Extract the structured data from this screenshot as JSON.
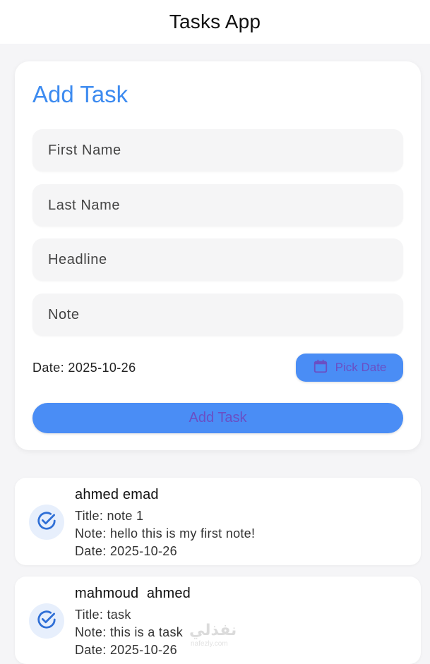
{
  "app": {
    "title": "Tasks App"
  },
  "form": {
    "title": "Add Task",
    "fields": {
      "first_name": {
        "placeholder": "First Name",
        "value": ""
      },
      "last_name": {
        "placeholder": "Last Name",
        "value": ""
      },
      "headline": {
        "placeholder": "Headline",
        "value": ""
      },
      "note": {
        "placeholder": "Note",
        "value": ""
      }
    },
    "date_text": "Date: 2025-10-26",
    "pick_date_label": "Pick Date",
    "pick_date_icon": "calendar-icon",
    "add_label": "Add Task"
  },
  "tasks": [
    {
      "name": "ahmed emad",
      "title": "Title: note 1",
      "note": "Note: hello this is my first note!",
      "date": "Date: 2025-10-26",
      "icon": "check-circle-icon"
    },
    {
      "name": "mahmoud  ahmed",
      "title": "Title: task",
      "note": "Note: this is a task",
      "date": "Date: 2025-10-26",
      "icon": "check-circle-icon"
    }
  ],
  "watermark": {
    "main": "نفذلي",
    "sub": "nafezly.com"
  },
  "colors": {
    "accent": "#3d8bf0",
    "button_bg": "#4a8df5",
    "button_text": "#6a4fc4",
    "background": "#f5f5f7"
  }
}
